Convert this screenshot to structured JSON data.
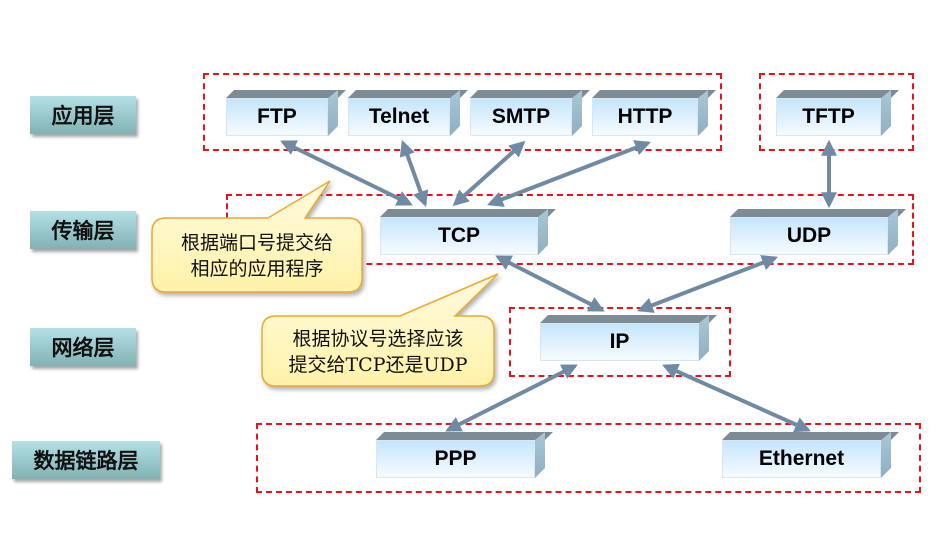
{
  "layers": [
    {
      "id": "application",
      "label": "应用层"
    },
    {
      "id": "transport",
      "label": "传输层"
    },
    {
      "id": "network",
      "label": "网络层"
    },
    {
      "id": "datalink",
      "label": "数据链路层"
    }
  ],
  "protocols": {
    "ftp": "FTP",
    "telnet": "Telnet",
    "smtp": "SMTP",
    "http": "HTTP",
    "tftp": "TFTP",
    "tcp": "TCP",
    "udp": "UDP",
    "ip": "IP",
    "ppp": "PPP",
    "ethernet": "Ethernet"
  },
  "connections": [
    {
      "from": "ftp",
      "to": "tcp"
    },
    {
      "from": "telnet",
      "to": "tcp"
    },
    {
      "from": "smtp",
      "to": "tcp"
    },
    {
      "from": "http",
      "to": "tcp"
    },
    {
      "from": "tftp",
      "to": "udp"
    },
    {
      "from": "tcp",
      "to": "ip"
    },
    {
      "from": "udp",
      "to": "ip"
    },
    {
      "from": "ip",
      "to": "ppp"
    },
    {
      "from": "ip",
      "to": "ethernet"
    }
  ],
  "callouts": [
    {
      "line1": "根据端口号提交给",
      "line2": "相应的应用程序"
    },
    {
      "line1": "根据协议号选择应该",
      "line2": "提交给TCP还是UDP"
    }
  ],
  "colors": {
    "group_border": "#e8141a",
    "arrow": "#6f8aa3",
    "callout_fill": "#fff8c8",
    "callout_border": "#f0a830"
  }
}
